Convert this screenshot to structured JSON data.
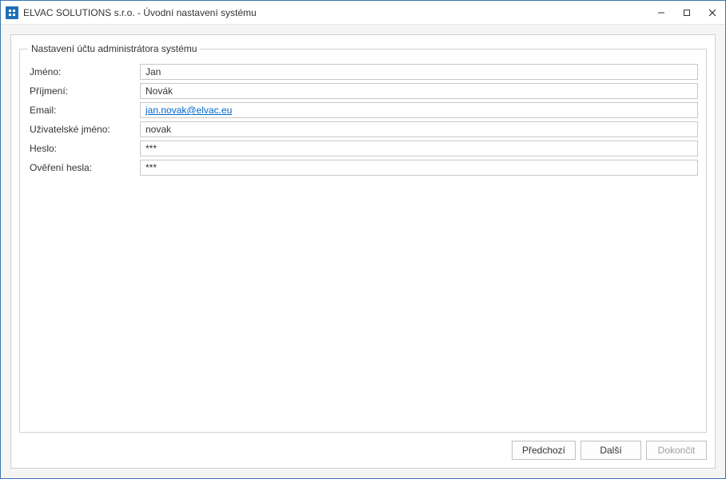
{
  "window": {
    "title": "ELVAC SOLUTIONS s.r.o. - Úvodní nastavení systému"
  },
  "group": {
    "title": "Nastavení účtu administrátora systému"
  },
  "form": {
    "firstname_label": "Jméno:",
    "firstname_value": "Jan",
    "lastname_label": "Příjmení:",
    "lastname_value": "Novák",
    "email_label": "Email:",
    "email_value": "jan.novak@elvac.eu",
    "username_label": "Uživatelské jméno:",
    "username_value": "novak",
    "password_label": "Heslo:",
    "password_value": "***",
    "password_confirm_label": "Ověření hesla:",
    "password_confirm_value": "***"
  },
  "buttons": {
    "prev": "Předchozí",
    "next": "Další",
    "finish": "Dokončit"
  }
}
